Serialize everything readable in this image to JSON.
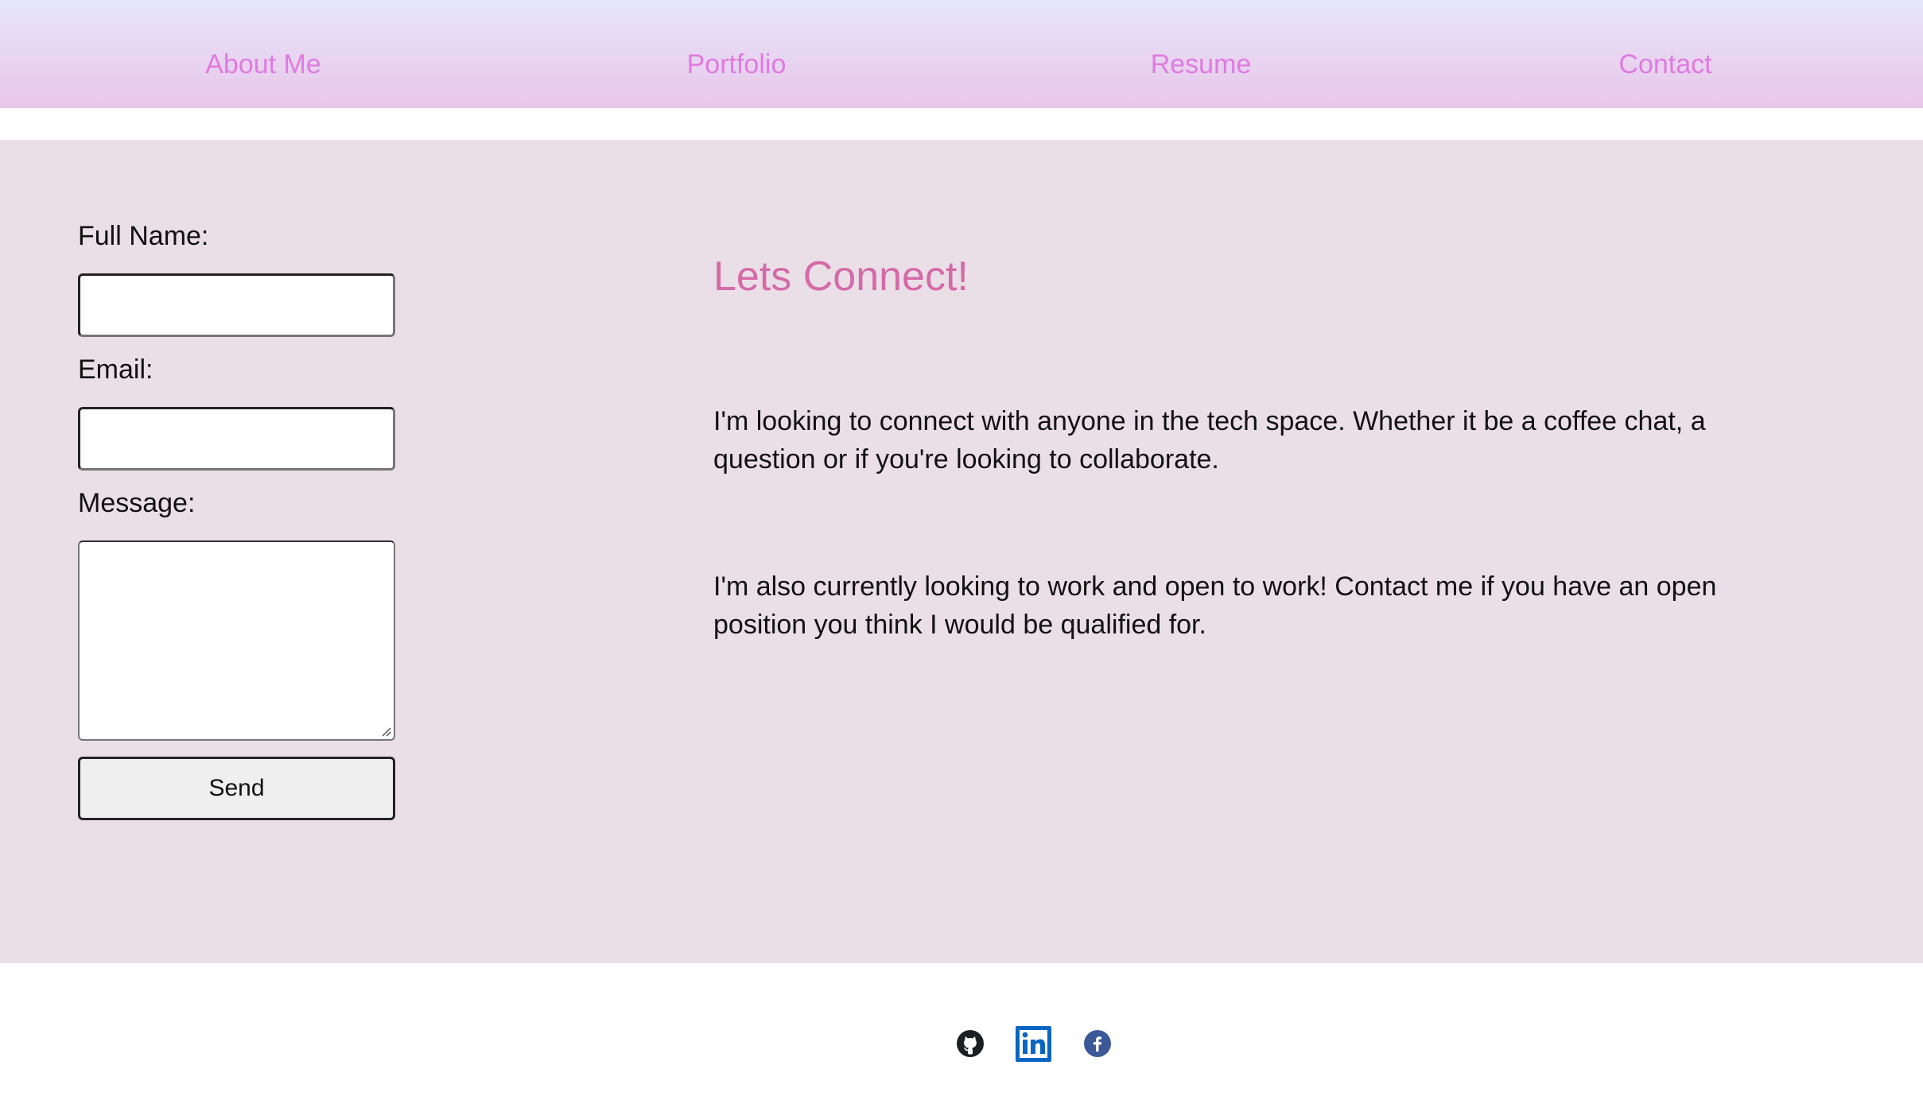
{
  "nav": {
    "items": [
      {
        "label": "About Me"
      },
      {
        "label": "Portfolio"
      },
      {
        "label": "Resume"
      },
      {
        "label": "Contact"
      }
    ]
  },
  "form": {
    "name_label": "Full Name:",
    "name_value": "",
    "email_label": "Email:",
    "email_value": "",
    "message_label": "Message:",
    "message_value": "",
    "send_label": "Send"
  },
  "content": {
    "heading": "Lets Connect!",
    "paragraph_1": "I'm looking to connect with anyone in the tech space. Whether it be a coffee chat, a question or if you're looking to collaborate.",
    "paragraph_2": "I'm also currently looking to work and open to work! Contact me if you have an open position you think I would be qualified for."
  },
  "footer": {
    "icons": [
      {
        "icon": "github-icon",
        "color": "#1b1f23"
      },
      {
        "icon": "linkedin-icon",
        "color": "#0a66c2"
      },
      {
        "icon": "facebook-icon",
        "color": "#3b5998"
      }
    ]
  },
  "colors": {
    "nav_text": "#e07ae0",
    "heading": "#d46aa8",
    "main_bg": "#ebdfe7",
    "nav_gradient_top": "#e6e6fa",
    "nav_gradient_bottom": "#e9c6ea"
  }
}
